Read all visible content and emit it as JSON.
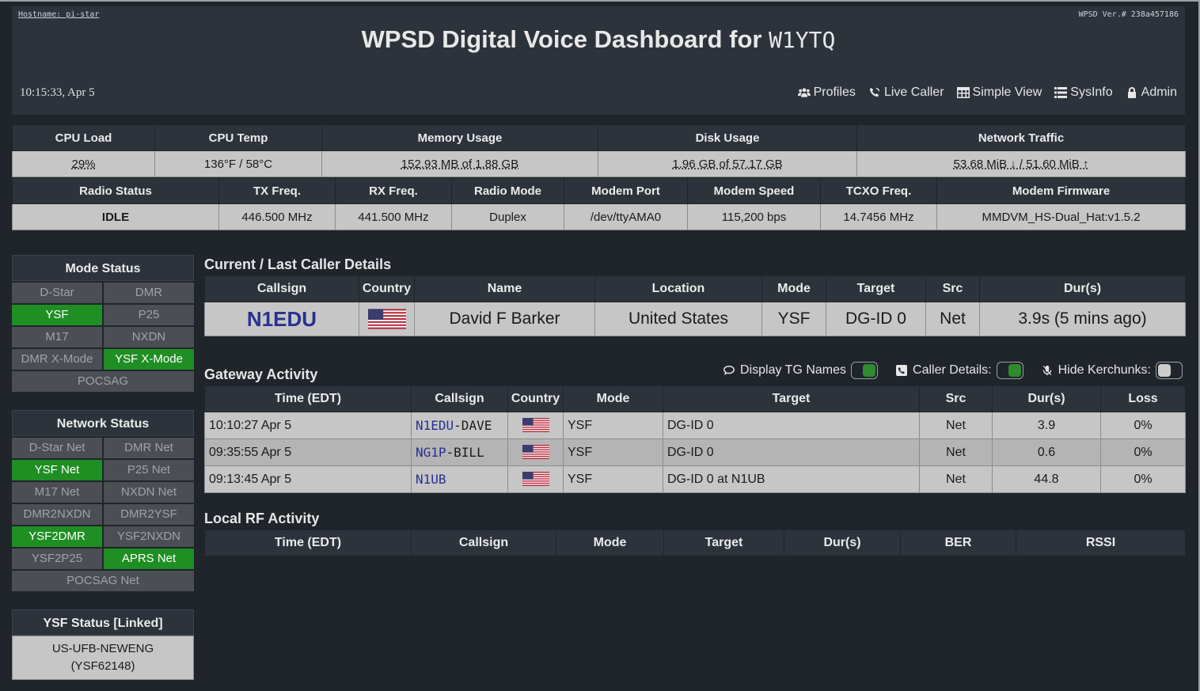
{
  "header": {
    "hostname": "Hostname: pi-star",
    "version": "WPSD Ver.# 238a457186",
    "title_prefix": "WPSD Digital Voice Dashboard for",
    "callsign": "W1YTQ",
    "clock": "10:15:33, Apr 5",
    "nav": [
      {
        "label": "Profiles",
        "icon": "users-icon"
      },
      {
        "label": "Live Caller",
        "icon": "phone-signal-icon"
      },
      {
        "label": "Simple View",
        "icon": "table-icon"
      },
      {
        "label": "SysInfo",
        "icon": "list-icon"
      },
      {
        "label": "Admin",
        "icon": "lock-icon"
      }
    ]
  },
  "system": {
    "headers": [
      "CPU Load",
      "CPU Temp",
      "Memory Usage",
      "Disk Usage",
      "Network Traffic"
    ],
    "values": [
      "29%",
      "136°F / 58°C",
      "152.93 MB of 1.88 GB",
      "1.96 GB of 57.17 GB",
      "53.68 MiB ↓ / 51.60 MiB ↑"
    ]
  },
  "radio": {
    "headers": [
      "Radio Status",
      "TX Freq.",
      "RX Freq.",
      "Radio Mode",
      "Modem Port",
      "Modem Speed",
      "TCXO Freq.",
      "Modem Firmware"
    ],
    "values": [
      "IDLE",
      "446.500 MHz",
      "441.500 MHz",
      "Duplex",
      "/dev/ttyAMA0",
      "115,200 bps",
      "14.7456 MHz",
      "MMDVM_HS-Dual_Hat:v1.5.2"
    ]
  },
  "mode_status": {
    "title": "Mode Status",
    "items": [
      {
        "label": "D-Star",
        "active": false
      },
      {
        "label": "DMR",
        "active": false
      },
      {
        "label": "YSF",
        "active": true
      },
      {
        "label": "P25",
        "active": false
      },
      {
        "label": "M17",
        "active": false
      },
      {
        "label": "NXDN",
        "active": false
      },
      {
        "label": "DMR X-Mode",
        "active": false
      },
      {
        "label": "YSF X-Mode",
        "active": true
      },
      {
        "label": "POCSAG",
        "active": false
      }
    ]
  },
  "network_status": {
    "title": "Network Status",
    "items": [
      {
        "label": "D-Star Net",
        "active": false
      },
      {
        "label": "DMR Net",
        "active": false
      },
      {
        "label": "YSF Net",
        "active": true
      },
      {
        "label": "P25 Net",
        "active": false
      },
      {
        "label": "M17 Net",
        "active": false
      },
      {
        "label": "NXDN Net",
        "active": false
      },
      {
        "label": "DMR2NXDN",
        "active": false
      },
      {
        "label": "DMR2YSF",
        "active": false
      },
      {
        "label": "YSF2DMR",
        "active": true
      },
      {
        "label": "YSF2NXDN",
        "active": false
      },
      {
        "label": "YSF2P25",
        "active": false
      },
      {
        "label": "APRS Net",
        "active": true
      },
      {
        "label": "POCSAG Net",
        "active": false
      }
    ]
  },
  "ysf_status": {
    "title": "YSF Status [Linked]",
    "line1": "US-UFB-NEWENG",
    "line2": "(YSF62148)"
  },
  "current_caller": {
    "title": "Current / Last Caller Details",
    "headers": [
      "Callsign",
      "Country",
      "Name",
      "Location",
      "Mode",
      "Target",
      "Src",
      "Dur(s)"
    ],
    "callsign": "N1EDU",
    "country_flag": "us-flag-icon",
    "name": "David F Barker",
    "location": "United States",
    "mode": "YSF",
    "target": "DG-ID 0",
    "src": "Net",
    "dur": "3.9s (5 mins ago)"
  },
  "gateway": {
    "title": "Gateway Activity",
    "toggles": [
      {
        "label": "Display TG Names",
        "on": true,
        "icon": "chat-icon"
      },
      {
        "label": "Caller Details:",
        "on": true,
        "icon": "phone-icon"
      },
      {
        "label": "Hide Kerchunks:",
        "on": false,
        "icon": "mic-off-icon"
      }
    ],
    "headers": [
      "Time (EDT)",
      "Callsign",
      "Country",
      "Mode",
      "Target",
      "Src",
      "Dur(s)",
      "Loss"
    ],
    "rows": [
      {
        "time": "10:10:27 Apr 5",
        "call": "N1EDU",
        "suffix": "-DAVE",
        "mode": "YSF",
        "target": "DG-ID 0",
        "src": "Net",
        "dur": "3.9",
        "loss": "0%"
      },
      {
        "time": "09:35:55 Apr 5",
        "call": "NG1P",
        "suffix": "-BILL",
        "mode": "YSF",
        "target": "DG-ID 0",
        "src": "Net",
        "dur": "0.6",
        "loss": "0%"
      },
      {
        "time": "09:13:45 Apr 5",
        "call": "N1UB",
        "suffix": "",
        "mode": "YSF",
        "target": "DG-ID 0 at N1UB",
        "src": "Net",
        "dur": "44.8",
        "loss": "0%"
      }
    ]
  },
  "local_rf": {
    "title": "Local RF Activity",
    "headers": [
      "Time (EDT)",
      "Callsign",
      "Mode",
      "Target",
      "Dur(s)",
      "BER",
      "RSSI"
    ]
  },
  "colors": {
    "page_bg": "#1f252b",
    "panel_bg": "#2c333b",
    "cell_bg": "#c6c6c6",
    "active_green": "#1f8e23",
    "callsign_blue": "#27318f"
  }
}
